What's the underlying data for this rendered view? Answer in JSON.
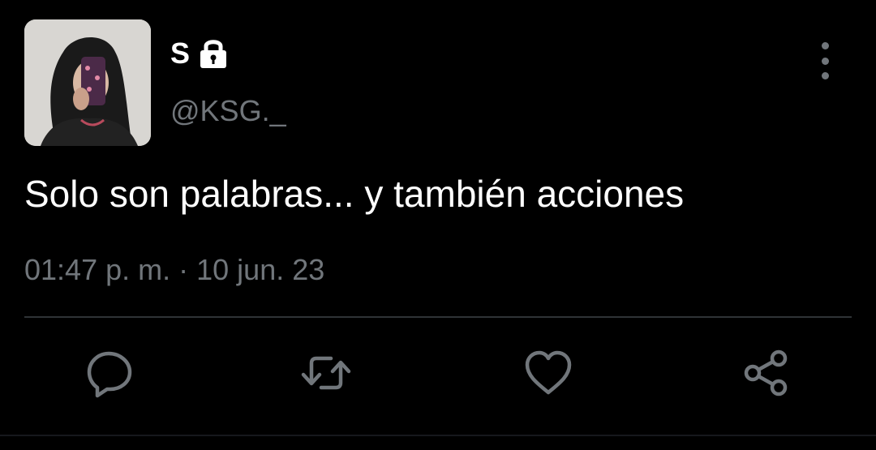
{
  "header": {
    "display_name": "S",
    "handle": "@KSG._",
    "avatar_icon": "profile-photo",
    "lock_icon": "lock-icon",
    "more_icon": "more-vertical-icon"
  },
  "tweet": {
    "text": "Solo son palabras... y también acciones",
    "time": "01:47 p. m.",
    "separator": "·",
    "date": "10 jun. 23"
  },
  "actions": [
    {
      "icon": "reply-icon"
    },
    {
      "icon": "retweet-icon"
    },
    {
      "icon": "like-icon"
    },
    {
      "icon": "share-icon"
    }
  ],
  "colors": {
    "background": "#000000",
    "text": "#ffffff",
    "muted": "#71767b",
    "divider": "#2f3336"
  }
}
